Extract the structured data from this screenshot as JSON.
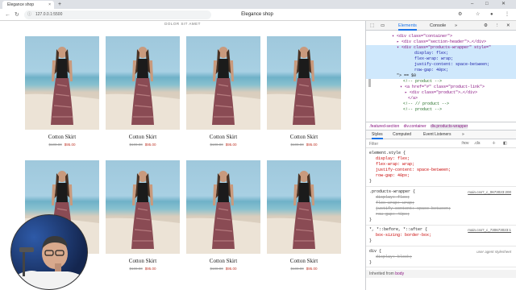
{
  "browser": {
    "tab_title": "Elegance shop",
    "url": "127.0.0.1:5500",
    "page_title": "Elegance shop"
  },
  "page": {
    "breadcrumb": "DOLOR SIT AMET",
    "products": [
      {
        "name": "Cotton Skirt",
        "old_price": "$100.00",
        "new_price": "$95.00"
      },
      {
        "name": "Cotton Skirt",
        "old_price": "$100.00",
        "new_price": "$95.00"
      },
      {
        "name": "Cotton Skirt",
        "old_price": "$100.00",
        "new_price": "$95.00"
      },
      {
        "name": "Cotton Skirt",
        "old_price": "$100.00",
        "new_price": "$95.00"
      },
      {
        "name": "Cotton Skirt",
        "old_price": "$100.00",
        "new_price": "$95.00"
      },
      {
        "name": "Cotton Skirt",
        "old_price": "$100.00",
        "new_price": "$95.00"
      },
      {
        "name": "Cotton Skirt",
        "old_price": "$100.00",
        "new_price": "$95.00"
      },
      {
        "name": "Cotton Skirt",
        "old_price": "$100.00",
        "new_price": "$95.00"
      }
    ]
  },
  "devtools": {
    "tabs": {
      "elements": "Elements",
      "console": "Console",
      "more": "»"
    },
    "dom_lines": [
      "<div class=\"container\">",
      "<div class=\"section-header\">…</div>",
      "<div class=\"products-wrapper\" style=\"",
      "display: flex;",
      "flex-wrap: wrap;",
      "justify-content: space-between;",
      "row-gap: 40px;",
      "\"> == $0",
      "<!-- product -->",
      "<a href=\"#\" class=\"product-link\">",
      "<div class=\"product\">…</div>",
      "</a>",
      "<!-- // product -->",
      "<!-- product -->"
    ],
    "breadcrumbs": [
      ".featured-section",
      "div.container",
      "div.products-wrapper"
    ],
    "subtabs": {
      "styles": "Styles",
      "computed": "Computed",
      "listeners": "Event Listeners",
      "more": "»"
    },
    "filter_placeholder": "Filter",
    "filter_hov": ":hov",
    "filter_cls": ".cls",
    "rules": {
      "element_style": {
        "selector": "element.style {",
        "decls": [
          "display: flex;",
          "flex-wrap: wrap;",
          "justify-content: space-between;",
          "row-gap: 40px;"
        ],
        "close": "}"
      },
      "products_wrapper": {
        "selector": ".products-wrapper {",
        "source": "main.css?_c_0673023:200",
        "decls": [
          "display: flex;",
          "flex-wrap: wrap;",
          "justify-content: space-between;",
          "row-gap: 40px;"
        ],
        "close": "}"
      },
      "universal": {
        "selector": "*, *::before, *::after {",
        "source": "main.css?_c_730673023:1",
        "decls": [
          "box-sizing: border-box;"
        ],
        "close": "}"
      },
      "div_ua": {
        "selector": "div {",
        "source": "user agent stylesheet",
        "decls": [
          "display: block;"
        ],
        "close": "}"
      }
    },
    "inherited_label": "Inherited from",
    "inherited_from": "body"
  },
  "colors": {
    "sale": "#c0392b",
    "accent": "#1a73e8"
  }
}
